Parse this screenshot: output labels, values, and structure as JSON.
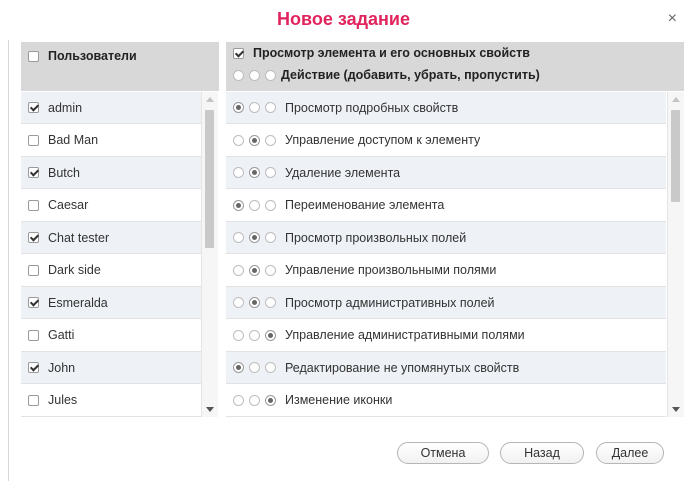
{
  "dialog": {
    "title": "Новое задание",
    "close": "×"
  },
  "users": {
    "header": "Пользователи",
    "header_checked": false,
    "items": [
      {
        "name": "admin",
        "checked": true
      },
      {
        "name": "Bad Man",
        "checked": false
      },
      {
        "name": "Butch",
        "checked": true
      },
      {
        "name": "Caesar",
        "checked": false
      },
      {
        "name": "Chat tester",
        "checked": true
      },
      {
        "name": "Dark side",
        "checked": false
      },
      {
        "name": "Esmeralda",
        "checked": true
      },
      {
        "name": "Gatti",
        "checked": false
      },
      {
        "name": "John",
        "checked": true
      },
      {
        "name": "Jules",
        "checked": false
      }
    ]
  },
  "permissions": {
    "header": "Просмотр элемента и его основных свойств",
    "header_checked": true,
    "subheader": "Действие (добавить, убрать, пропустить)",
    "items": [
      {
        "label": "Просмотр подробных свойств",
        "selected": 0
      },
      {
        "label": "Управление доступом к элементу",
        "selected": 1
      },
      {
        "label": "Удаление элемента",
        "selected": 1
      },
      {
        "label": "Переименование элемента",
        "selected": 0
      },
      {
        "label": "Просмотр произвольных полей",
        "selected": 1
      },
      {
        "label": "Управление произвольными полями",
        "selected": 1
      },
      {
        "label": "Просмотр административных полей",
        "selected": 1
      },
      {
        "label": "Управление административными полями",
        "selected": 2
      },
      {
        "label": "Редактирование не упомянутых свойств",
        "selected": 0
      },
      {
        "label": "Изменение иконки",
        "selected": 2
      }
    ]
  },
  "buttons": {
    "cancel": "Отмена",
    "back": "Назад",
    "next": "Далее"
  },
  "colors": {
    "title": "#e0245e",
    "header_bg": "#d8d8d8",
    "alt_row": "#eef1f6"
  }
}
